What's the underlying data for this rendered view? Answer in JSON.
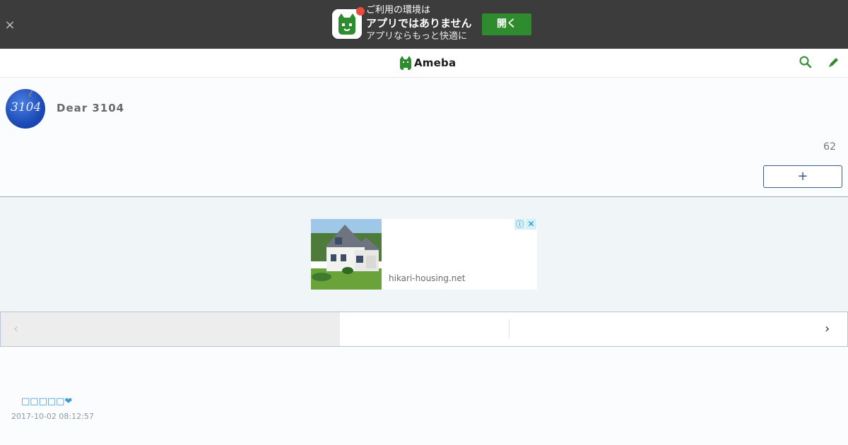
{
  "banner": {
    "line1": "ご利用の環境は",
    "line2": "アプリではありません",
    "line3": "アプリならもっと快適に",
    "open_label": "開く",
    "close_glyph": "×"
  },
  "header": {
    "logo_text": "Ameba",
    "search_icon": "search-icon",
    "edit_icon": "pencil-icon"
  },
  "profile": {
    "avatar_text": "3104",
    "blog_title": "Dear 3104",
    "follower_count": "62",
    "follow_label": "+"
  },
  "ad": {
    "domain": "hikari-housing.net",
    "info_glyph": "ⓘ",
    "close_glyph": "✕"
  },
  "pager": {
    "prev_glyph": "‹",
    "next_glyph": "›"
  },
  "entry": {
    "title": "□□□□□❤",
    "date": "2017-10-02 08:12:57"
  },
  "colors": {
    "brand_green": "#2e8b2e",
    "banner_bg": "#3c3c3c",
    "link_blue": "#3e9ad6",
    "follow_border": "#3d5a85"
  }
}
